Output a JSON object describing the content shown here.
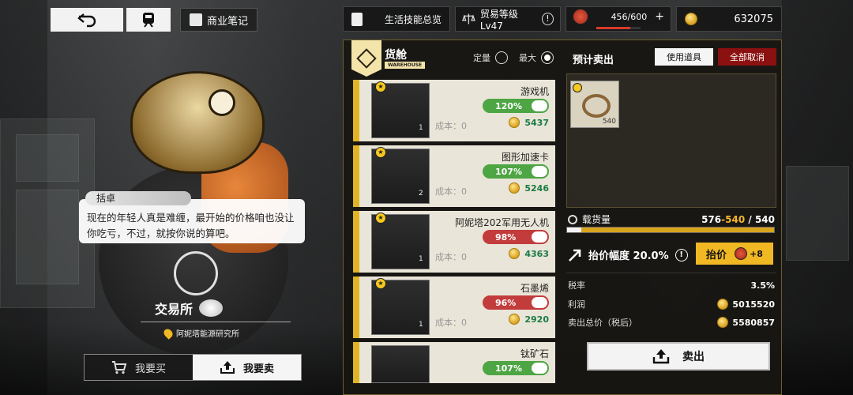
{
  "topbar": {
    "business_notes_label": "商业笔记",
    "skills_label": "生活技能总览",
    "trade_level_label": "贸易等级Lv47",
    "trade_info": "!",
    "stamina": "456/600",
    "stamina_plus": "+",
    "stamina_fraction": 0.76,
    "money": "632075"
  },
  "icons": {
    "back": "back-arrow-icon",
    "train": "train-icon",
    "notes": "notebook-icon",
    "skills": "document-icon",
    "trade": "scales-icon",
    "stamina": "red-face-icon",
    "coin": "coin-icon"
  },
  "dialog": {
    "speaker": "括卓",
    "text": "现在的年轻人真是难缠，最开始的价格咱也没让你吃亏，不过，就按你说的算吧。"
  },
  "station": {
    "name": "交易所",
    "location": "阿妮塔能源研究所"
  },
  "mode_tabs": [
    {
      "label": "我要买",
      "active": false
    },
    {
      "label": "我要卖",
      "active": true
    }
  ],
  "hold": {
    "title": "货舱",
    "badge_text": "WAREHOUSE",
    "option_fixed": "定量",
    "option_max": "最大"
  },
  "items": [
    {
      "name": "游戏机",
      "pct": "120%",
      "trend": "up",
      "cost": "成本：0",
      "price": "5437",
      "qty": "1"
    },
    {
      "name": "图形加速卡",
      "pct": "107%",
      "trend": "up",
      "cost": "成本：0",
      "price": "5246",
      "qty": "2"
    },
    {
      "name": "阿妮塔202军用无人机",
      "pct": "98%",
      "trend": "down",
      "cost": "成本：0",
      "price": "4363",
      "qty": "1"
    },
    {
      "name": "石墨烯",
      "pct": "96%",
      "trend": "down",
      "cost": "成本：0",
      "price": "2920",
      "qty": "1"
    },
    {
      "name": "钛矿石",
      "pct": "107%",
      "trend": "up",
      "cost": "",
      "price": "",
      "qty": ""
    }
  ],
  "sell": {
    "title": "预计卖出",
    "use_item_label": "使用道具",
    "cancel_all_label": "全部取消",
    "slot_qty": "540"
  },
  "cargo": {
    "label": "载货量",
    "current": "576",
    "added": "-540",
    "sep": "/",
    "max": "540",
    "fill_fraction": 0.07
  },
  "markup": {
    "label": "抬价幅度 20.0%",
    "info": "!",
    "button_label": "抬价",
    "button_cost": "+8"
  },
  "stats": {
    "tax_label": "税率",
    "tax_value": "3.5%",
    "profit_label": "利润",
    "profit_value": "5015520",
    "total_label": "卖出总价（税后）",
    "total_value": "5580857"
  },
  "sell_button_label": "卖出",
  "colors": {
    "accent": "#f0b823",
    "up": "#4da543",
    "down": "#c33c3c",
    "cancel": "#8b1010"
  }
}
